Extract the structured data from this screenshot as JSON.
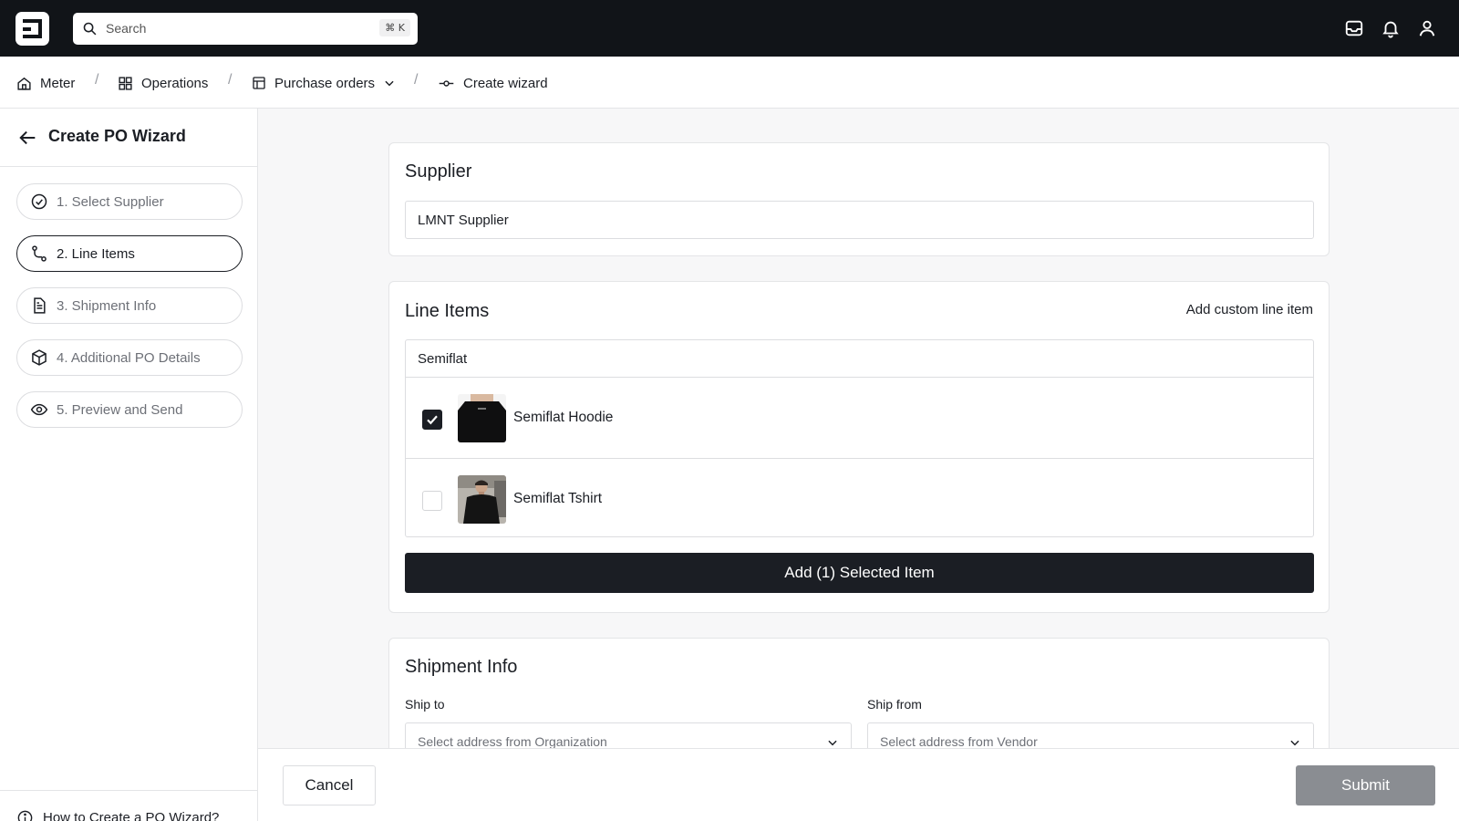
{
  "topbar": {
    "search_placeholder": "Search",
    "shortcut": "⌘ K",
    "icons": [
      "inbox-icon",
      "bell-icon",
      "user-icon"
    ]
  },
  "breadcrumb": {
    "items": [
      {
        "label": "Meter",
        "icon": "home-icon"
      },
      {
        "label": "Operations",
        "icon": "grid-icon"
      },
      {
        "label": "Purchase orders",
        "icon": "table-icon"
      },
      {
        "label": "Create wizard",
        "icon": "commit-icon"
      }
    ],
    "separator": "/"
  },
  "sidebar": {
    "title": "Create PO Wizard",
    "steps": [
      {
        "label": "1. Select Supplier",
        "icon": "check-circle-icon"
      },
      {
        "label": "2. Line Items",
        "icon": "route-icon"
      },
      {
        "label": "3. Shipment Info",
        "icon": "document-icon"
      },
      {
        "label": "4. Additional PO Details",
        "icon": "box-icon"
      },
      {
        "label": "5. Preview and Send",
        "icon": "eye-icon"
      }
    ],
    "help": "How to Create a PO Wizard?"
  },
  "supplier": {
    "title": "Supplier",
    "value": "LMNT Supplier"
  },
  "line_items": {
    "title": "Line Items",
    "custom_link": "Add custom line item",
    "filter": "Semiflat",
    "items": [
      {
        "name": "Semiflat Hoodie",
        "checked": true
      },
      {
        "name": "Semiflat Tshirt",
        "checked": false
      }
    ],
    "add_button": "Add (1) Selected Item"
  },
  "shipment": {
    "title": "Shipment Info",
    "ship_to_label": "Ship to",
    "ship_to_placeholder": "Select address from Organization",
    "ship_from_label": "Ship from",
    "ship_from_placeholder": "Select address from Vendor"
  },
  "footer": {
    "cancel": "Cancel",
    "submit": "Submit"
  },
  "colors": {
    "topbar": "#111418",
    "primary": "#1b1e24",
    "submit_disabled": "#8a8d92"
  }
}
